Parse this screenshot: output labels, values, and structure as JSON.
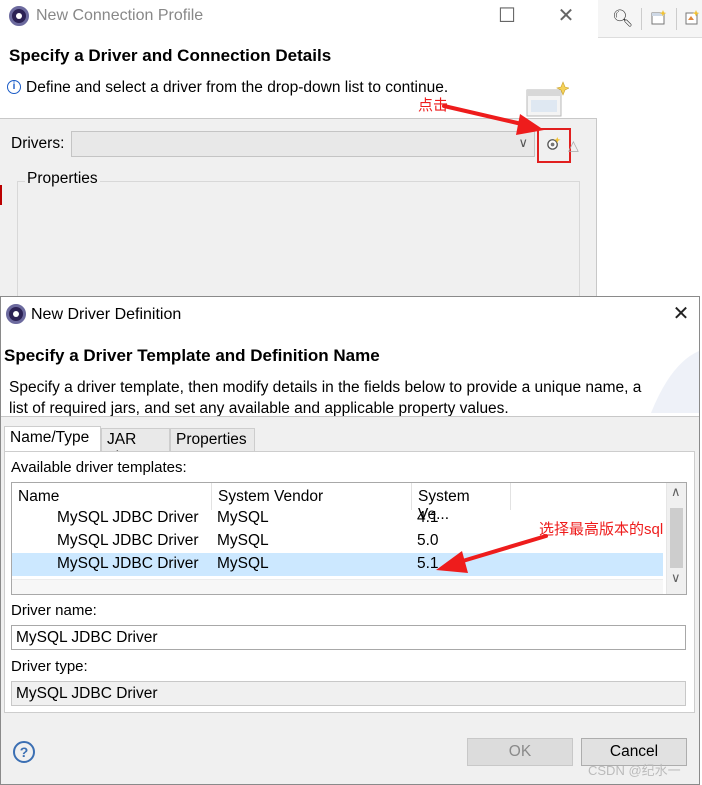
{
  "connection_profile": {
    "title": "New Connection Profile",
    "header_title": "Specify a Driver and Connection Details",
    "header_desc": "Define and select a driver from the drop-down list to continue.",
    "drivers_label": "Drivers:",
    "drivers_value": "",
    "properties_label": "Properties"
  },
  "annotations": {
    "click_note": "点击",
    "select_note": "选择最高版本的sql",
    "color": "#ee1c1c"
  },
  "driver_dialog": {
    "title": "New Driver Definition",
    "header_title": "Specify a Driver Template and Definition Name",
    "header_desc": "Specify a driver template, then modify details in the fields below to provide a unique name, a list of required jars, and set any available and applicable property values.",
    "tabs": [
      {
        "label": "Name/Type",
        "active": true
      },
      {
        "label": "JAR List",
        "active": false
      },
      {
        "label": "Properties",
        "active": false
      }
    ],
    "templates_label": "Available driver templates:",
    "table": {
      "columns": [
        "Name",
        "System Vendor",
        "System Ve..."
      ],
      "rows": [
        {
          "name": "MySQL JDBC Driver",
          "vendor": "MySQL",
          "version": "4.1",
          "selected": false
        },
        {
          "name": "MySQL JDBC Driver",
          "vendor": "MySQL",
          "version": "5.0",
          "selected": false
        },
        {
          "name": "MySQL JDBC Driver",
          "vendor": "MySQL",
          "version": "5.1",
          "selected": true
        }
      ]
    },
    "driver_name_label": "Driver name:",
    "driver_name_value": "MySQL JDBC Driver",
    "driver_type_label": "Driver type:",
    "driver_type_value": "MySQL JDBC Driver",
    "help_symbol": "?",
    "ok_label": "OK",
    "cancel_label": "Cancel"
  },
  "watermark": "CSDN @纪水一",
  "colors": {
    "selection": "#cce8ff",
    "highlight_box": "#e11f1f",
    "dialog_bg": "#f0f0f0"
  }
}
